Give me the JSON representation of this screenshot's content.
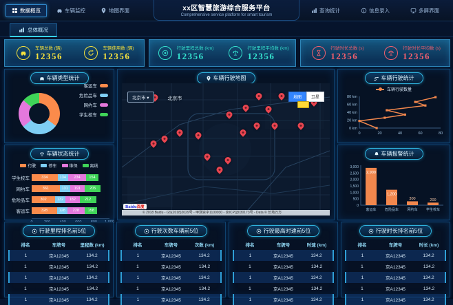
{
  "header": {
    "title": "xx区智慧旅游综合服务平台",
    "subtitle": "Comprehensive service platform for smart tourism",
    "nav_left": [
      {
        "label": "数据概览",
        "icon": "grid-icon",
        "active": true
      },
      {
        "label": "车辆监控",
        "icon": "car-icon",
        "active": false
      },
      {
        "label": "地图界面",
        "icon": "pin-icon",
        "active": false
      }
    ],
    "nav_right": [
      {
        "label": "查询统计",
        "icon": "bars-icon"
      },
      {
        "label": "信息录入",
        "icon": "info-icon"
      },
      {
        "label": "多屏界面",
        "icon": "screen-icon"
      }
    ]
  },
  "subtab": {
    "label": "总体概况",
    "icon": "bars-icon"
  },
  "stats": {
    "groups": [
      {
        "color": "#f5e13d",
        "items": [
          {
            "icon": "car-icon",
            "label": "车辆总数 (辆)",
            "value": "12356"
          },
          {
            "icon": "refresh-icon",
            "label": "车辆使用数 (辆)",
            "value": "12356"
          }
        ]
      },
      {
        "color": "#35e3cf",
        "items": [
          {
            "icon": "target-icon",
            "label": "行驶里程总数 (km)",
            "value": "12356"
          },
          {
            "icon": "scale-icon",
            "label": "行驶里程平均数 (km)",
            "value": "12356"
          }
        ]
      },
      {
        "color": "#f25f6d",
        "items": [
          {
            "icon": "hourglass-icon",
            "label": "行驶时长总数 (s)",
            "value": "12356"
          },
          {
            "icon": "scale-icon",
            "label": "行驶时长平均数 (s)",
            "value": "12356"
          }
        ]
      }
    ]
  },
  "map": {
    "title": "车辆行驶地图",
    "title_icon": "pin-icon",
    "city_selector": "北京市",
    "city_label": "北京市",
    "btn_map": "地图",
    "btn_satellite": "卫星",
    "logo": "Baidu",
    "logo_cn": "百度",
    "attribution": "© 2018 Baidu - GS(2018)2029号 - 甲测资字1100930 - 京ICP证030173号 - Data © 长地万方",
    "pins": [
      [
        65.9,
        12
      ],
      [
        76.8,
        12
      ],
      [
        92.4,
        16.7
      ],
      [
        59.6,
        20.8
      ],
      [
        70.5,
        21.9
      ],
      [
        51.7,
        26
      ],
      [
        15.9,
        13
      ],
      [
        64.9,
        34.4
      ],
      [
        73.5,
        34.4
      ],
      [
        86.1,
        34.4
      ],
      [
        27.8,
        39.6
      ],
      [
        36.8,
        41.7
      ],
      [
        58.3,
        39.6
      ],
      [
        20.5,
        44.3
      ],
      [
        15.2,
        47.9
      ],
      [
        41.1,
        57.8
      ],
      [
        51,
        60.4
      ],
      [
        47,
        67.7
      ]
    ]
  },
  "chart_data": [
    {
      "type": "pie",
      "title": "车辆类型统计",
      "icon": "car-icon",
      "labels": [
        "客运车",
        "危险品车",
        "网约车",
        "学生校车"
      ],
      "values": [
        35,
        29,
        22,
        14
      ],
      "colors": [
        "#fb8b4b",
        "#7ecef4",
        "#e478dd",
        "#3fd458"
      ],
      "legend_position": "right",
      "donut": true
    },
    {
      "type": "bar",
      "orientation": "horizontal",
      "stacked": true,
      "title": "车辆状态统计",
      "icon": "scale-icon",
      "categories": [
        "学生校车",
        "网约车",
        "危险品车",
        "客运车"
      ],
      "series": [
        {
          "name": "行驶",
          "color": "#fb8b4b",
          "values": [
            334,
            361,
            302,
            328
          ]
        },
        {
          "name": "停车",
          "color": "#7ecef4",
          "values": [
            134,
            131,
            132,
            128
          ]
        },
        {
          "name": "维保",
          "color": "#e478dd",
          "values": [
            234,
            191,
            182,
            228
          ]
        },
        {
          "name": "离线",
          "color": "#3fd458",
          "values": [
            154,
            205,
            212,
            158
          ]
        }
      ],
      "xlim": [
        0,
        1000
      ],
      "xticks": [
        "0",
        "200",
        "400",
        "600",
        "800",
        "1,000"
      ]
    },
    {
      "type": "line",
      "title": "车辆行驶统计",
      "icon": "route-icon",
      "series_name": "车辆行驶数量",
      "color": "#f1874d",
      "points": [
        [
          17,
          0
        ],
        [
          0,
          18
        ],
        [
          25,
          26
        ],
        [
          45,
          34
        ],
        [
          27,
          45
        ],
        [
          65,
          57
        ],
        [
          55,
          66
        ],
        [
          75,
          78
        ]
      ],
      "xticks": [
        "0",
        "20",
        "40",
        "60",
        "80"
      ],
      "yticks": [
        "0 km",
        "20 km",
        "40 km",
        "60 km",
        "80 km"
      ],
      "xlim": [
        0,
        80
      ],
      "ylim": [
        0,
        80
      ]
    },
    {
      "type": "bar",
      "title": "车辆报警统计",
      "icon": "bell-icon",
      "categories": [
        "客运车",
        "危险品车",
        "网约车",
        "学生校车"
      ],
      "values": [
        2900,
        1200,
        300,
        200
      ],
      "value_labels": [
        "2,900",
        "1,200",
        "300",
        "200"
      ],
      "color": "#f1874d",
      "yticks": [
        "0",
        "500",
        "1,000",
        "1,500",
        "2,000",
        "2,500",
        "3,000"
      ],
      "ylim": [
        0,
        3000
      ]
    }
  ],
  "tables": [
    {
      "title": "行驶里程排名前5位",
      "icon": "target-icon",
      "columns": [
        "排名",
        "车牌号",
        "里程数 (km)"
      ],
      "rows": [
        [
          "1",
          "京A12345",
          "134.2"
        ],
        [
          "1",
          "京A12345",
          "134.2"
        ],
        [
          "1",
          "京A12345",
          "134.2"
        ],
        [
          "1",
          "京A12345",
          "134.2"
        ],
        [
          "1",
          "京A12345",
          "134.2"
        ]
      ]
    },
    {
      "title": "行驶次数车辆前5位",
      "icon": "target-icon",
      "columns": [
        "排名",
        "车牌号",
        "次数 (km)"
      ],
      "rows": [
        [
          "1",
          "京A12345",
          "134.2"
        ],
        [
          "1",
          "京A12345",
          "134.2"
        ],
        [
          "1",
          "京A12345",
          "134.2"
        ],
        [
          "1",
          "京A12345",
          "134.2"
        ],
        [
          "1",
          "京A12345",
          "134.2"
        ]
      ]
    },
    {
      "title": "行驶最高时速前5位",
      "icon": "target-icon",
      "columns": [
        "排名",
        "车牌号",
        "时速 (km)"
      ],
      "rows": [
        [
          "1",
          "京A12345",
          "134.2"
        ],
        [
          "1",
          "京A12345",
          "134.2"
        ],
        [
          "1",
          "京A12345",
          "134.2"
        ],
        [
          "1",
          "京A12345",
          "134.2"
        ],
        [
          "1",
          "京A12345",
          "134.2"
        ]
      ]
    },
    {
      "title": "行驶时长排名前5位",
      "icon": "target-icon",
      "columns": [
        "排名",
        "车牌号",
        "时长 (km)"
      ],
      "rows": [
        [
          "1",
          "京A12345",
          "134.2"
        ],
        [
          "1",
          "京A12345",
          "134.2"
        ],
        [
          "1",
          "京A12345",
          "134.2"
        ],
        [
          "1",
          "京A12345",
          "134.2"
        ],
        [
          "1",
          "京A12345",
          "134.2"
        ]
      ]
    }
  ]
}
